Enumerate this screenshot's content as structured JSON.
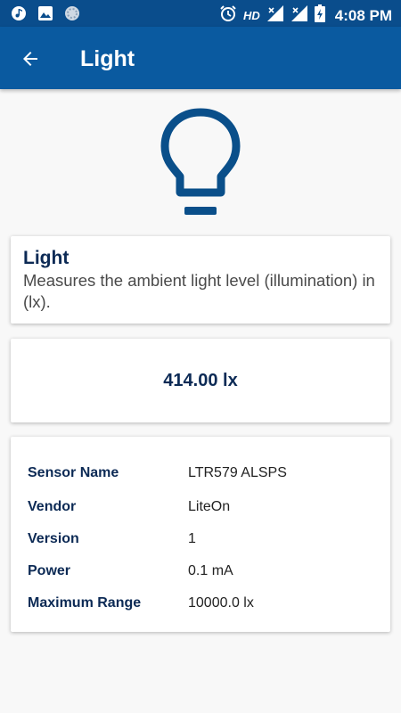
{
  "status_bar": {
    "time": "4:08 PM",
    "hd_label": "HD",
    "icons": [
      "music-icon",
      "image-icon",
      "circle-icon",
      "alarm-icon",
      "signal-icon",
      "signal-icon",
      "battery-charging-icon"
    ]
  },
  "app_bar": {
    "title": "Light",
    "back_icon": "arrow-back-icon"
  },
  "hero_icon": "lightbulb-icon",
  "description": {
    "title": "Light",
    "text": "Measures the ambient light level (illumination) in (lx)."
  },
  "reading": {
    "value": "414.00 lx"
  },
  "sensor_info": [
    {
      "label": "Sensor Name",
      "value": "LTR579 ALSPS"
    },
    {
      "label": "Vendor",
      "value": "LiteOn"
    },
    {
      "label": "Version",
      "value": "1"
    },
    {
      "label": "Power",
      "value": "0.1 mA"
    },
    {
      "label": "Maximum Range",
      "value": "10000.0 lx"
    }
  ],
  "colors": {
    "status_bar": "#0a4d8c",
    "app_bar": "#0a5aa0",
    "accent_dark": "#0c2a55",
    "bulb": "#0a4f8a"
  }
}
